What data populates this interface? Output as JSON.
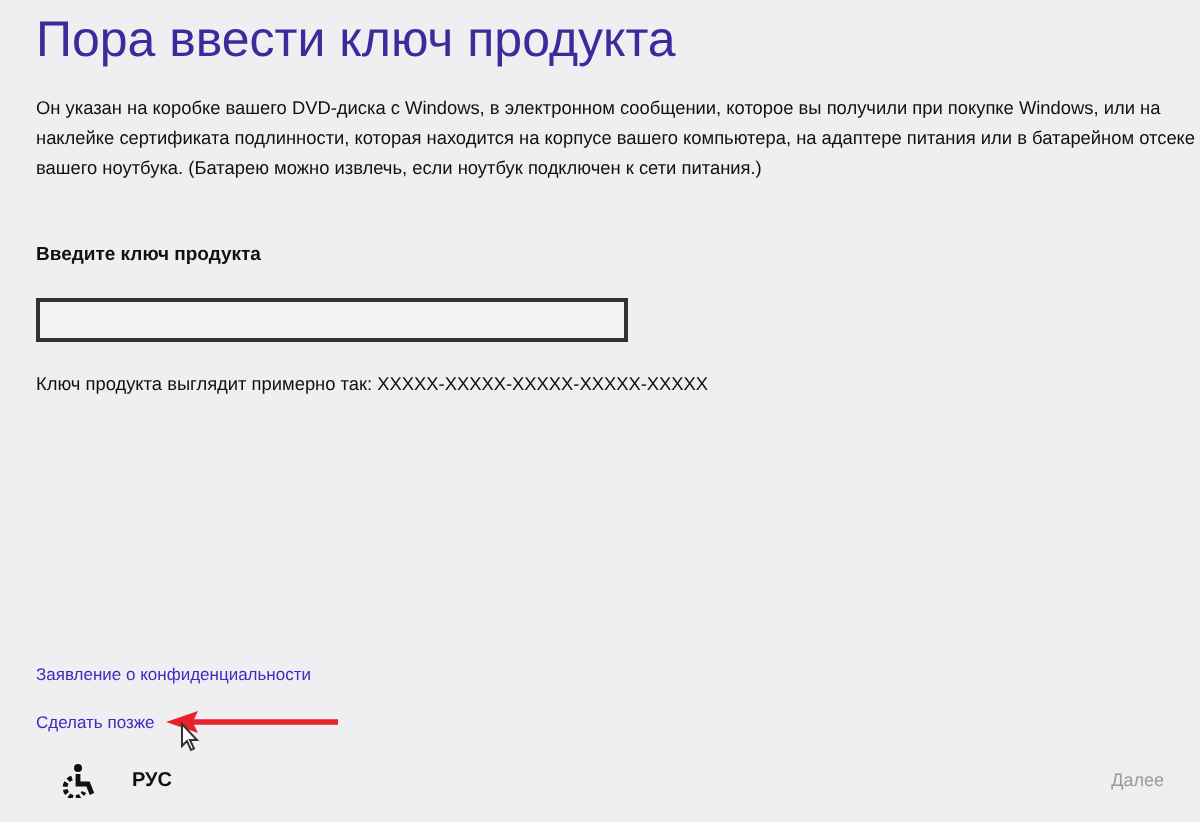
{
  "title": "Пора ввести ключ продукта",
  "description": "Он указан на коробке вашего DVD-диска с Windows, в электронном сообщении, которое вы получили при покупке Windows, или на наклейке сертификата подлинности, которая находится на корпусе вашего компьютера, на адаптере питания или в батарейном отсеке вашего ноутбука. (Батарею можно извлечь, если ноутбук подключен к сети питания.)",
  "key_label": "Введите ключ продукта",
  "example": "Ключ продукта выглядит примерно так: XXXXX-XXXXX-XXXXX-XXXXX-XXXXX",
  "links": [
    {
      "label": "Заявление о конфиденциальности",
      "kind": "link"
    },
    {
      "label": "Сделать позже",
      "kind": "annotated"
    }
  ],
  "language": "РУС",
  "next_button": {
    "label": "Далее",
    "disabled": true
  }
}
